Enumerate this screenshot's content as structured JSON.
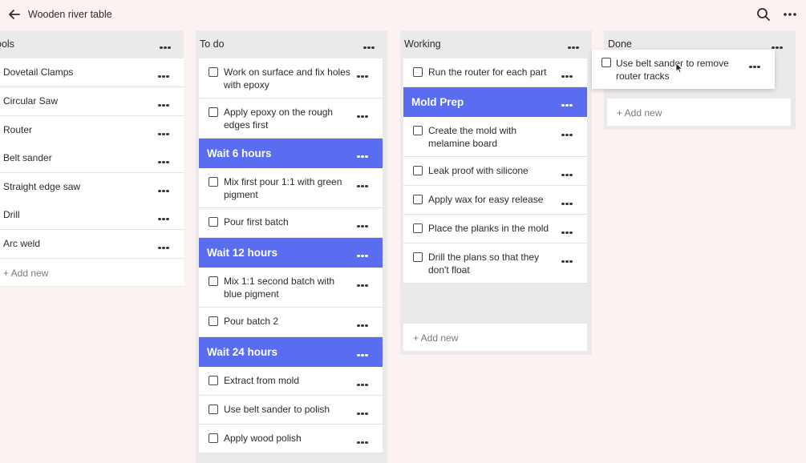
{
  "app": {
    "title": "Wooden river table"
  },
  "icons": {
    "back": "arrow-left-icon",
    "search": "search-icon",
    "more": "more-horizontal-icon",
    "cursor": "mouse-cursor-icon"
  },
  "colors": {
    "background": "#fbf2f1",
    "column_bg": "#ebe9e9",
    "section_header": "#5a6df0"
  },
  "columns": {
    "tools": {
      "title": "Tools",
      "visible_title": "ools",
      "items": [
        "Dovetail Clamps",
        "Circular Saw",
        "Router",
        "Belt sander",
        "Straight edge saw",
        "Drill",
        "Arc weld"
      ],
      "add_new": "+ Add new"
    },
    "todo": {
      "title": "To do",
      "items": [
        {
          "type": "task",
          "text": "Work on surface and fix holes with epoxy"
        },
        {
          "type": "task",
          "text": "Apply epoxy on the rough edges first"
        },
        {
          "type": "header",
          "text": "Wait 6 hours"
        },
        {
          "type": "task",
          "text": "Mix first pour 1:1 with green pigment"
        },
        {
          "type": "task",
          "text": "Pour first batch"
        },
        {
          "type": "header",
          "text": "Wait 12 hours"
        },
        {
          "type": "task",
          "text": "Mix 1:1 second batch with blue pigment"
        },
        {
          "type": "task",
          "text": "Pour batch 2"
        },
        {
          "type": "header",
          "text": "Wait 24 hours"
        },
        {
          "type": "task",
          "text": "Extract from mold"
        },
        {
          "type": "task",
          "text": "Use belt sander to polish"
        },
        {
          "type": "task",
          "text": "Apply wood polish"
        }
      ]
    },
    "working": {
      "title": "Working",
      "items": [
        {
          "type": "task",
          "text": "Run the router for each part"
        },
        {
          "type": "header",
          "text": "Mold Prep"
        },
        {
          "type": "task",
          "text": "Create the mold with melamine board"
        },
        {
          "type": "task",
          "text": "Leak proof with silicone"
        },
        {
          "type": "task",
          "text": "Apply wax for easy release"
        },
        {
          "type": "task",
          "text": "Place the planks in the mold"
        },
        {
          "type": "task",
          "text": "Drill the plans so that they don't float"
        }
      ],
      "add_new": "+ Add new"
    },
    "done": {
      "title": "Done",
      "add_new": "+ Add new"
    }
  },
  "dragging_card": {
    "text": "Use belt sander to remove router tracks"
  }
}
